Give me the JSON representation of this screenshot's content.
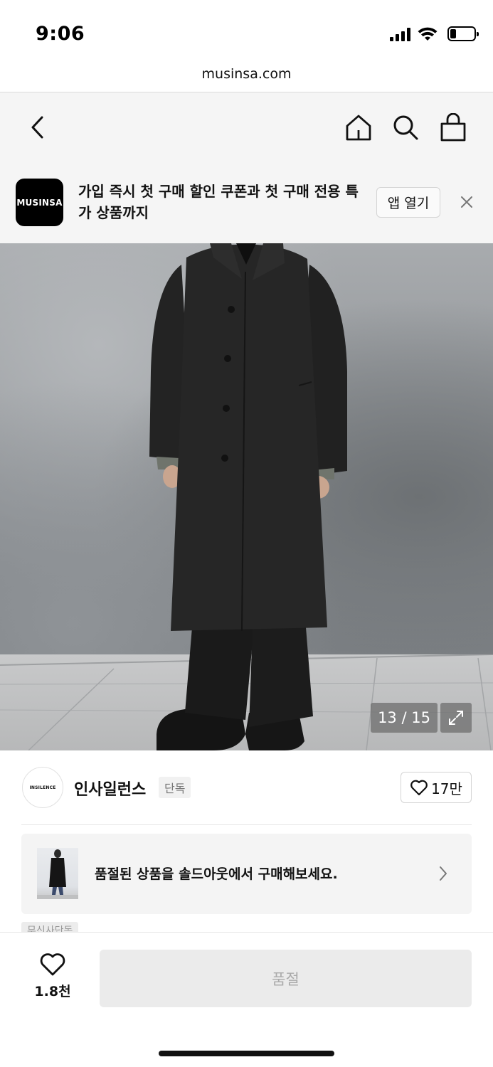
{
  "status_bar": {
    "time": "9:06",
    "battery_level": 0.25
  },
  "browser": {
    "url": "musinsa.com"
  },
  "nav": {
    "icons": [
      "back-arrow-icon",
      "home-icon",
      "search-icon",
      "shopping-bag-icon"
    ]
  },
  "app_banner": {
    "logo_text": "MUSINSA",
    "message": "가입 즉시 첫 구매 할인 쿠폰과 첫 구매 전용 특가 상품까지",
    "open_label": "앱 열기"
  },
  "gallery": {
    "counter": "13 / 15"
  },
  "brand": {
    "logo_text": "INSILENCE",
    "name": "인사일런스",
    "badge": "단독",
    "like_count": "17만"
  },
  "soldout_promo": {
    "message": "품절된 상품을 솔드아웃에서 구매해보세요."
  },
  "partial_tag": "무신사단독",
  "bottom_bar": {
    "wish_count": "1.8천",
    "buy_label": "품절"
  }
}
